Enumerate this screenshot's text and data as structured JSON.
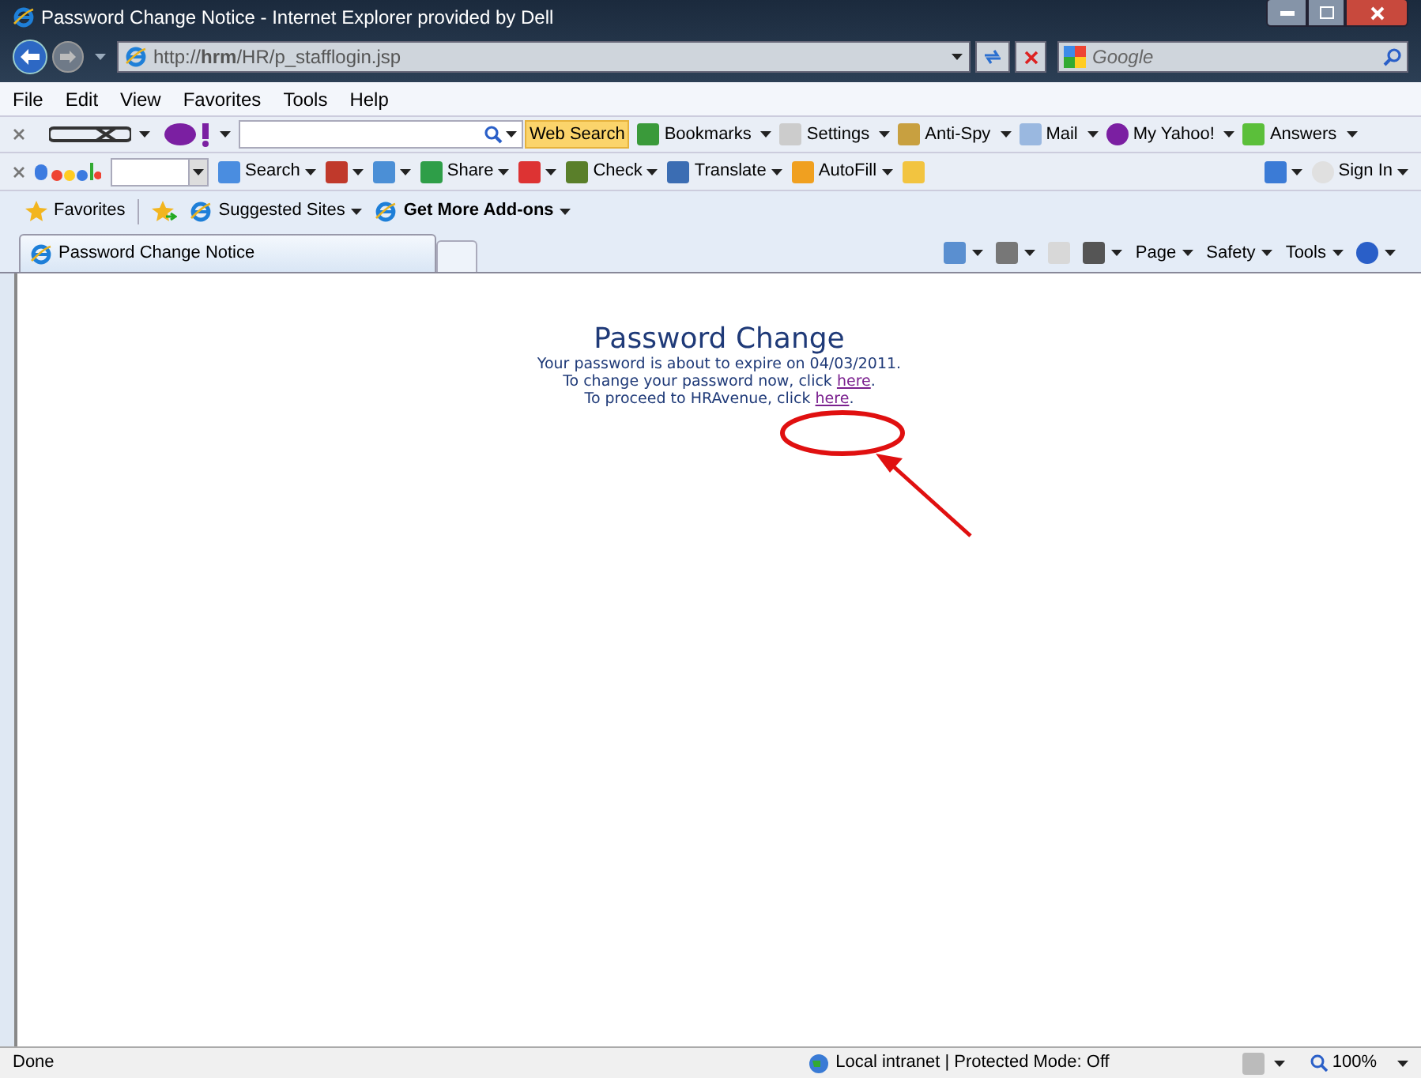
{
  "window": {
    "title": "Password Change Notice - Internet Explorer provided by Dell"
  },
  "address_bar": {
    "url": "http://**hrm**/HR/p_stafflogin.jsp"
  },
  "search_box": {
    "placeholder": "Google"
  },
  "menu": [
    "File",
    "Edit",
    "View",
    "Favorites",
    "Tools",
    "Help"
  ],
  "divx_toolbar": {
    "search_button": "Web Search",
    "items": [
      {
        "label": "Bookmarks",
        "dropdown": true
      },
      {
        "label": "Settings",
        "dropdown": true
      },
      {
        "label": "Anti-Spy",
        "dropdown": true
      },
      {
        "label": "Mail",
        "dropdown": true
      },
      {
        "label": "My Yahoo!",
        "dropdown": true
      },
      {
        "label": "Answers",
        "dropdown": true
      }
    ]
  },
  "google_toolbar": {
    "items": [
      {
        "kind": "labeled",
        "label": "Search",
        "dropdown": true
      },
      {
        "kind": "icon",
        "dropdown": true
      },
      {
        "kind": "icon",
        "dropdown": true
      },
      {
        "kind": "labeled",
        "label": "Share",
        "dropdown": true
      },
      {
        "kind": "icon",
        "dropdown": true
      },
      {
        "kind": "labeled",
        "label": "Check",
        "dropdown": true
      },
      {
        "kind": "labeled",
        "label": "Translate",
        "dropdown": true
      },
      {
        "kind": "labeled",
        "label": "AutoFill",
        "dropdown": true
      },
      {
        "kind": "icon",
        "dropdown": false
      }
    ],
    "right_items": [
      {
        "kind": "icon",
        "dropdown": true
      },
      {
        "kind": "labeled",
        "label": "Sign In",
        "dropdown": true
      }
    ]
  },
  "favorites_bar": {
    "items": [
      {
        "label": "Favorites",
        "dropdown": false,
        "bold": false
      },
      {
        "label": "Suggested Sites",
        "dropdown": true,
        "bold": false
      },
      {
        "label": "Get More Add-ons",
        "dropdown": true,
        "bold": true
      }
    ]
  },
  "tabs": [
    {
      "label": "Password Change Notice",
      "selected": true
    }
  ],
  "command_bar": {
    "items": [
      {
        "kind": "icon",
        "dropdown": true
      },
      {
        "kind": "icon",
        "dropdown": true
      },
      {
        "kind": "icon",
        "dropdown": false
      },
      {
        "kind": "icon",
        "dropdown": true
      },
      {
        "kind": "labeled",
        "label": "Page",
        "dropdown": true
      },
      {
        "kind": "labeled",
        "label": "Safety",
        "dropdown": true
      },
      {
        "kind": "labeled",
        "label": "Tools",
        "dropdown": true
      },
      {
        "kind": "icon",
        "dropdown": true
      }
    ]
  },
  "page": {
    "heading": "Password Change",
    "lines": [
      {
        "text": "Your password is about to expire on 04/03/2011."
      },
      {
        "text": "To change your password now, click ",
        "link": "here",
        "after": "."
      },
      {
        "text": "To proceed to HRAvenue, click ",
        "link": "here",
        "after": "."
      }
    ]
  },
  "status_bar": {
    "text": "Done",
    "zone": "Local intranet | Protected Mode: Off",
    "zoom": "100%"
  }
}
